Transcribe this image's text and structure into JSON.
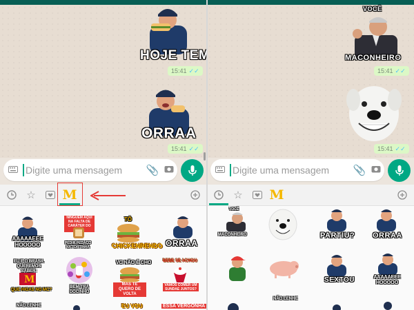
{
  "left": {
    "stickers": [
      {
        "caption": "HOJE TEM",
        "time": "15:41"
      },
      {
        "caption": "ORRAA",
        "time": "15:41"
      }
    ],
    "input": {
      "placeholder": "Digite uma mensagem"
    },
    "tray_items": [
      {
        "caption": "AAAAAEEE HOOOOO"
      },
      {
        "caption": "NINGUÉM AQUI NA FALTA DE CARÁTER DO QUE"
      },
      {
        "caption": "PEDIR PEDAÇO NA TORTINHA"
      },
      {
        "caption": "TÔ"
      },
      {
        "caption": "CHICKENRENDO"
      },
      {
        "caption": "ORRAA"
      },
      {
        "caption": "EU E O BRASIL QUEREMOS SABER:"
      },
      {
        "caption": "QUE HIGAS NO MC?"
      },
      {
        "caption": "BEM-TRA DOCINHO"
      },
      {
        "caption": "VC NÃO É CHO"
      },
      {
        "caption": "MAS TE QUERO DE VOLTA"
      },
      {
        "caption": "BEBE SE ACHOU"
      },
      {
        "caption": "VAMOS COMER UM SUNDAE JUNTOS?"
      },
      {
        "caption": "NÃO LENHE"
      },
      {
        "caption": "EU VOU"
      },
      {
        "caption": "ESSA VERGONHA"
      }
    ]
  },
  "right": {
    "stickers": [
      {
        "caption_top": "VOCÊ",
        "caption": "MACONHEIRO",
        "time": "15:41"
      },
      {
        "caption": "",
        "time": "15:41"
      }
    ],
    "input": {
      "placeholder": "Digite uma mensagem"
    },
    "tray_items": [
      {
        "caption_top": "VOCÊ",
        "caption": "MACONHEIRO"
      },
      {
        "caption": "PARTIU?"
      },
      {
        "caption": "ORRAA"
      },
      {
        "caption": "SEXTOU"
      },
      {
        "caption": "AAAAAEEE HOOOOO"
      },
      {
        "caption": "NÃO LENHE"
      }
    ]
  },
  "colors": {
    "accent": "#00a884",
    "annotation": "#e53935",
    "mcdonalds": "#f5b800"
  },
  "icons": [
    "keyboard-icon",
    "paperclip-icon",
    "camera-icon",
    "mic-icon",
    "clock-icon",
    "star-icon",
    "heart-icon",
    "mcdonalds-icon",
    "plus-icon"
  ]
}
